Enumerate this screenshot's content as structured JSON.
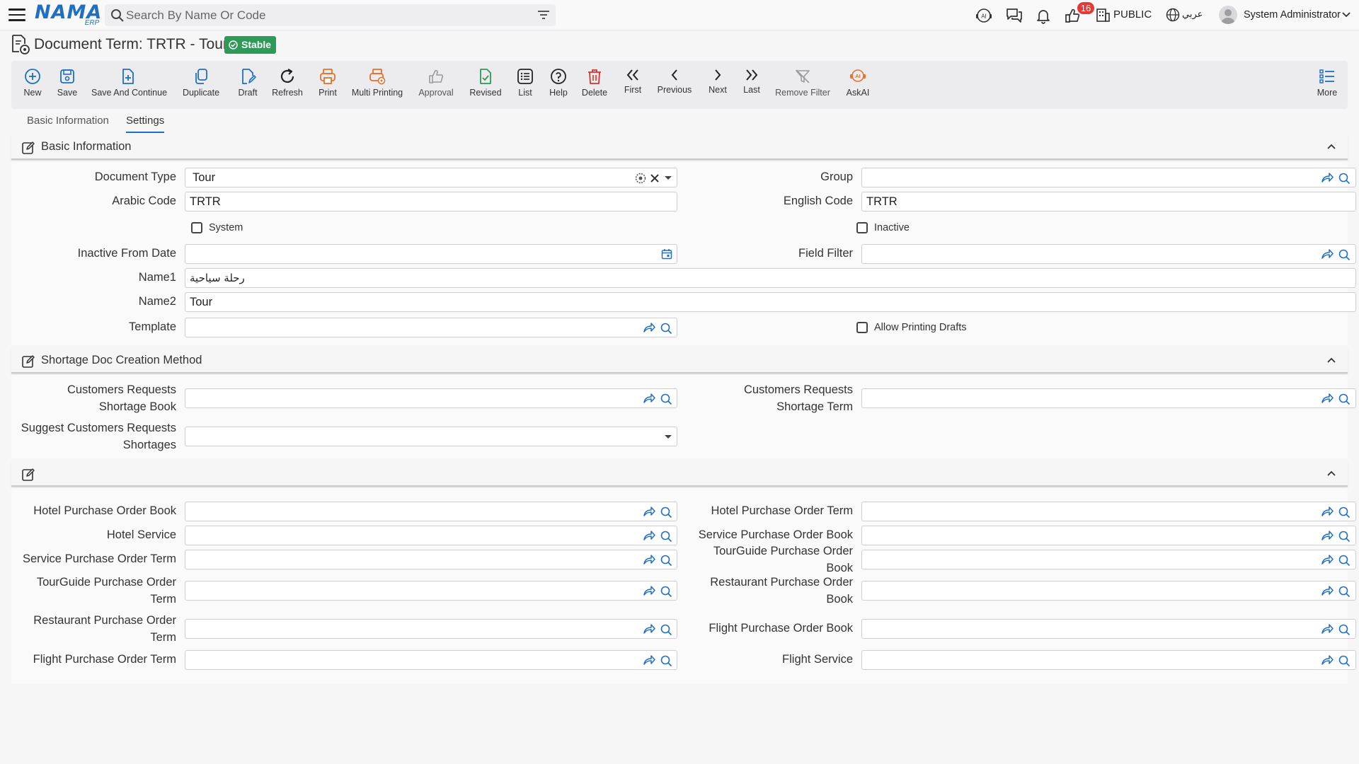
{
  "topbar": {
    "logo_text": "NAMA",
    "logo_sub": "ERP",
    "search_placeholder": "Search By Name Or Code",
    "notification_count": "16",
    "public_label": "PUBLIC",
    "language_label": "عربي",
    "user_name": "System Administrator"
  },
  "page": {
    "title": "Document Term: TRTR - Tour",
    "status": "Stable"
  },
  "toolbar": {
    "buttons": [
      {
        "label": "New",
        "icon": "plus-circle-icon"
      },
      {
        "label": "Save",
        "icon": "save-icon"
      },
      {
        "label": "Save And Continue",
        "icon": "save-continue-icon"
      },
      {
        "label": "Duplicate",
        "icon": "duplicate-icon"
      },
      {
        "label": "Draft",
        "icon": "draft-icon"
      },
      {
        "label": "Refresh",
        "icon": "refresh-icon"
      },
      {
        "label": "Print",
        "icon": "print-icon"
      },
      {
        "label": "Multi Printing",
        "icon": "multi-print-icon"
      },
      {
        "label": "Approval",
        "icon": "thumbs-up-icon"
      },
      {
        "label": "Revised",
        "icon": "revised-icon"
      },
      {
        "label": "List",
        "icon": "list-icon"
      },
      {
        "label": "Help",
        "icon": "help-icon"
      },
      {
        "label": "Delete",
        "icon": "trash-icon"
      },
      {
        "label": "First",
        "icon": "double-chevron-left-icon"
      },
      {
        "label": "Previous",
        "icon": "chevron-left-icon"
      },
      {
        "label": "Next",
        "icon": "chevron-right-icon"
      },
      {
        "label": "Last",
        "icon": "double-chevron-right-icon"
      },
      {
        "label": "Remove Filter",
        "icon": "remove-filter-icon"
      },
      {
        "label": "AskAI",
        "icon": "ai-icon"
      },
      {
        "label": "More",
        "icon": "more-list-icon"
      }
    ]
  },
  "tabs": [
    {
      "label": "Basic Information"
    },
    {
      "label": "Settings"
    }
  ],
  "sections": {
    "basic": {
      "title": "Basic Information",
      "document_type_label": "Document Type",
      "document_type_value": "Tour",
      "group_label": "Group",
      "arabic_code_label": "Arabic Code",
      "arabic_code_value": "TRTR",
      "english_code_label": "English Code",
      "english_code_value": "TRTR",
      "system_label": "System",
      "inactive_label": "Inactive",
      "inactive_from_label": "Inactive From Date",
      "field_filter_label": "Field Filter",
      "name1_label": "Name1",
      "name1_value": "رحلة سياحية",
      "name2_label": "Name2",
      "name2_value": "Tour",
      "template_label": "Template",
      "allow_printing_label": "Allow Printing Drafts"
    },
    "shortage": {
      "title": "Shortage Doc Creation Method",
      "cust_req_book_label_1": "Customers Requests",
      "cust_req_book_label_2": "Shortage Book",
      "cust_req_term_label_1": "Customers Requests",
      "cust_req_term_label_2": "Shortage Term",
      "suggest_label_1": "Suggest Customers Requests",
      "suggest_label_2": "Shortages"
    },
    "purchase": {
      "title": "",
      "fields_left": [
        [
          "Hotel Purchase Order Book"
        ],
        [
          "Hotel Service"
        ],
        [
          "Service Purchase Order Term"
        ],
        [
          "TourGuide Purchase Order",
          "Term"
        ],
        [
          "Restaurant Purchase Order",
          "Term"
        ],
        [
          "Flight Purchase Order Term"
        ]
      ],
      "fields_right": [
        [
          "Hotel Purchase Order Term"
        ],
        [
          "Service Purchase Order Book"
        ],
        [
          "TourGuide Purchase Order",
          "Book"
        ],
        [
          "Restaurant Purchase Order",
          "Book"
        ],
        [
          "Flight Purchase Order Book"
        ],
        [
          "Flight Service"
        ]
      ]
    }
  },
  "colors": {
    "brand": "#1f6fc4",
    "stable": "#2e9a57",
    "print": "#e8702a",
    "delete": "#d9332b",
    "revised": "#2e9a57"
  }
}
